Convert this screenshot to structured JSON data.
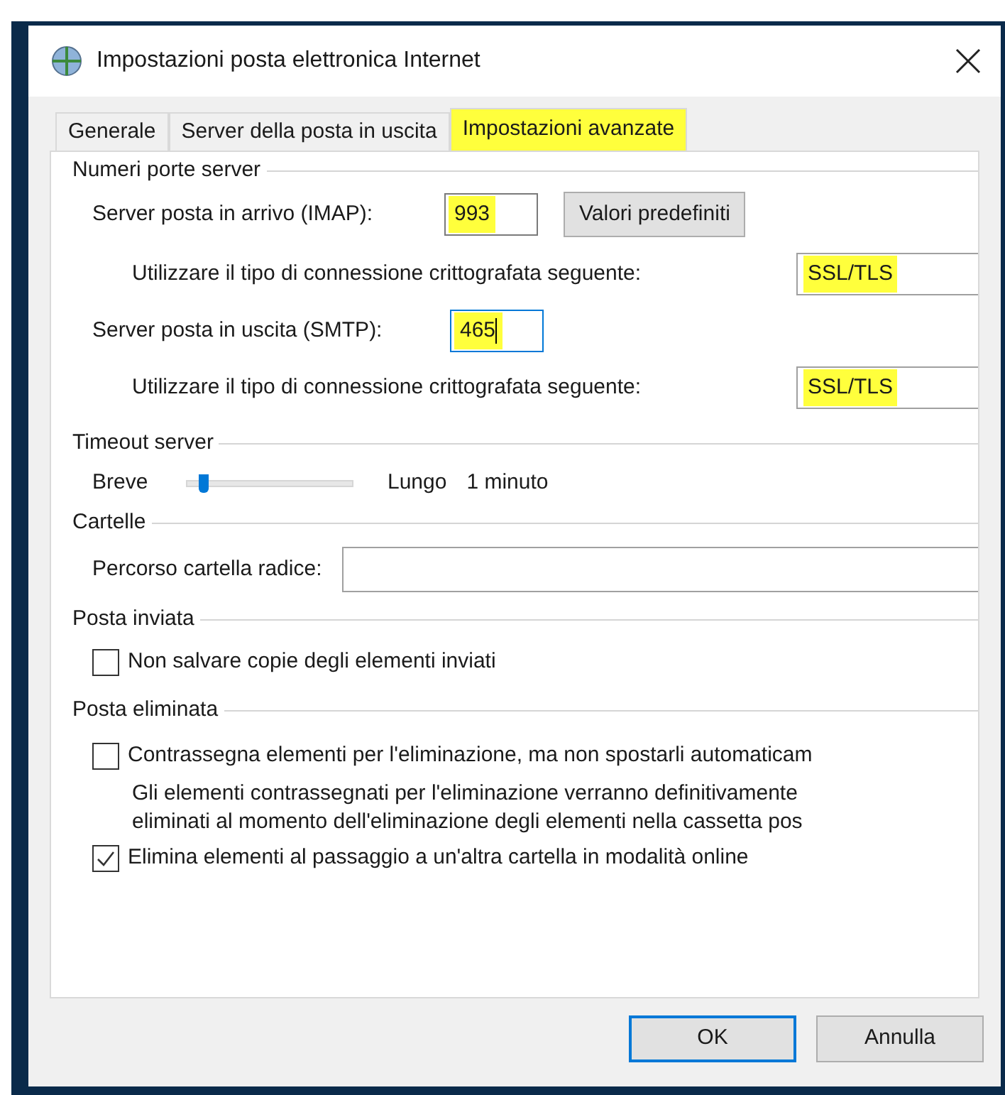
{
  "window": {
    "title": "Impostazioni posta elettronica Internet"
  },
  "tabs": [
    {
      "label": "Generale",
      "selected": false,
      "highlighted": false
    },
    {
      "label": "Server della posta in uscita",
      "selected": false,
      "highlighted": false
    },
    {
      "label": "Impostazioni avanzate",
      "selected": true,
      "highlighted": true
    }
  ],
  "server_ports": {
    "title": "Numeri porte server",
    "incoming": {
      "label": "Server posta in arrivo (IMAP):",
      "value": "993",
      "highlighted": true,
      "focused": false
    },
    "defaults_button": "Valori predefiniti",
    "incoming_encryption": {
      "label": "Utilizzare il tipo di connessione crittografata seguente:",
      "value": "SSL/TLS",
      "highlighted": true
    },
    "outgoing": {
      "label": "Server posta in uscita (SMTP):",
      "value": "465",
      "highlighted": true,
      "focused": true
    },
    "outgoing_encryption": {
      "label": "Utilizzare il tipo di connessione crittografata seguente:",
      "value": "SSL/TLS",
      "highlighted": true
    }
  },
  "timeout": {
    "title": "Timeout server",
    "min_label": "Breve",
    "max_label": "Lungo",
    "level": 0.1,
    "reading": "1 minuto"
  },
  "folders": {
    "title": "Cartelle",
    "root_label": "Percorso cartella radice:"
  },
  "sent": {
    "title": "Posta inviata",
    "checkbox": {
      "label": "Non salvare copie degli elementi inviati",
      "checked": false
    }
  },
  "deleted": {
    "title": "Posta eliminata",
    "mark": {
      "label": "Contrassegna elementi per l'eliminazione, ma non spostarli automaticam",
      "checked": false
    },
    "note": [
      "Gli elementi contrassegnati per l'eliminazione verranno definitivamente",
      "eliminati al momento dell'eliminazione degli elementi nella cassetta pos"
    ],
    "purge": {
      "label": "Elimina elementi al passaggio a un'altra cartella in modalità online",
      "checked": true
    }
  },
  "buttons": [
    {
      "label": "OK",
      "default": true
    },
    {
      "label": "Annulla",
      "default": false
    }
  ]
}
